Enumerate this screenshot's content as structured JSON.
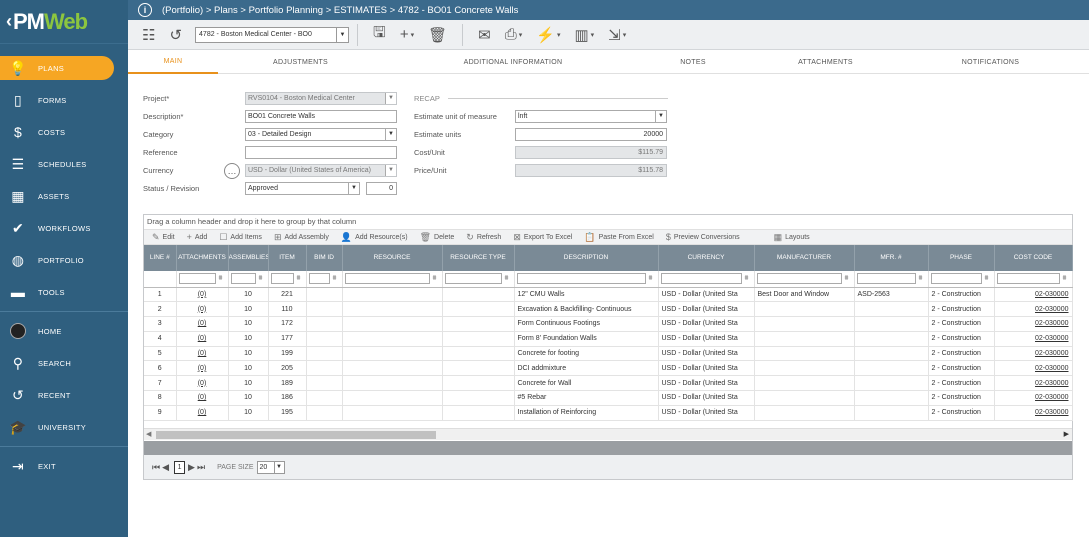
{
  "app": {
    "logo_prefix": "PM",
    "logo_suffix": "Web"
  },
  "breadcrumb": "(Portfolio) > Plans > Portfolio Planning > ESTIMATES > 4782 - BO01 Concrete Walls",
  "sidebar": {
    "items": [
      {
        "label": "PLANS",
        "icon": "lightbulb-icon"
      },
      {
        "label": "FORMS",
        "icon": "document-icon"
      },
      {
        "label": "COSTS",
        "icon": "dollar-icon"
      },
      {
        "label": "SCHEDULES",
        "icon": "schedule-icon"
      },
      {
        "label": "ASSETS",
        "icon": "building-icon"
      },
      {
        "label": "WORKFLOWS",
        "icon": "check-icon"
      },
      {
        "label": "PORTFOLIO",
        "icon": "globe-icon"
      },
      {
        "label": "TOOLS",
        "icon": "toolbox-icon"
      },
      {
        "label": "HOME",
        "icon": "avatar-icon"
      },
      {
        "label": "SEARCH",
        "icon": "search-icon"
      },
      {
        "label": "RECENT",
        "icon": "history-icon"
      },
      {
        "label": "UNIVERSITY",
        "icon": "graduation-icon"
      },
      {
        "label": "EXIT",
        "icon": "exit-icon"
      }
    ]
  },
  "toolbar": {
    "record_select": "4782 - Boston Medical Center - BO0"
  },
  "tabs": [
    "MAIN",
    "ADJUSTMENTS",
    "ADDITIONAL INFORMATION",
    "NOTES",
    "ATTACHMENTS",
    "NOTIFICATIONS"
  ],
  "form": {
    "project_label": "Project*",
    "project_value": "RVS0104 - Boston Medical Center",
    "description_label": "Description*",
    "description_value": "BO01 Concrete Walls",
    "category_label": "Category",
    "category_value": "03 - Detailed Design",
    "reference_label": "Reference",
    "reference_value": "",
    "currency_label": "Currency",
    "currency_value": "USD - Dollar (United States of America)",
    "status_label": "Status / Revision",
    "status_value": "Approved",
    "revision_value": "0",
    "recap_label": "RECAP",
    "uom_label": "Estimate unit of measure",
    "uom_value": "lnft",
    "units_label": "Estimate units",
    "units_value": "20000",
    "cost_unit_label": "Cost/Unit",
    "cost_unit_value": "$115.79",
    "price_unit_label": "Price/Unit",
    "price_unit_value": "$115.78"
  },
  "grid": {
    "group_hint": "Drag a column header and drop it here to group by that column",
    "tools": [
      "Edit",
      "Add",
      "Add Items",
      "Add Assembly",
      "Add Resource(s)",
      "Delete",
      "Refresh",
      "Export To Excel",
      "Paste From Excel",
      "Preview Conversions",
      "Layouts"
    ],
    "columns": [
      "LINE #",
      "ATTACHMENTS",
      "ASSEMBLIES",
      "ITEM",
      "BIM ID",
      "RESOURCE",
      "RESOURCE TYPE",
      "DESCRIPTION",
      "CURRENCY",
      "MANUFACTURER",
      "MFR. #",
      "PHASE",
      "COST CODE"
    ],
    "rows": [
      {
        "line": "1",
        "att": "(0)",
        "asm": "10",
        "item": "221",
        "desc": "12\" CMU Walls",
        "cur": "USD - Dollar (United Sta",
        "mfr": "Best Door and Window",
        "mfrno": "ASD-2563",
        "phase": "2 - Construction",
        "code": "02-030000"
      },
      {
        "line": "2",
        "att": "(0)",
        "asm": "10",
        "item": "110",
        "desc": "Excavation & Backfilling- Continuous",
        "cur": "USD - Dollar (United Sta",
        "mfr": "",
        "mfrno": "",
        "phase": "2 - Construction",
        "code": "02-030000"
      },
      {
        "line": "3",
        "att": "(0)",
        "asm": "10",
        "item": "172",
        "desc": "Form Continuous Footings",
        "cur": "USD - Dollar (United Sta",
        "mfr": "",
        "mfrno": "",
        "phase": "2 - Construction",
        "code": "02-030000"
      },
      {
        "line": "4",
        "att": "(0)",
        "asm": "10",
        "item": "177",
        "desc": "Form 8' Foundation Walls",
        "cur": "USD - Dollar (United Sta",
        "mfr": "",
        "mfrno": "",
        "phase": "2 - Construction",
        "code": "02-030000"
      },
      {
        "line": "5",
        "att": "(0)",
        "asm": "10",
        "item": "199",
        "desc": "Concrete for footing",
        "cur": "USD - Dollar (United Sta",
        "mfr": "",
        "mfrno": "",
        "phase": "2 - Construction",
        "code": "02-030000"
      },
      {
        "line": "6",
        "att": "(0)",
        "asm": "10",
        "item": "205",
        "desc": "DCI addmixture",
        "cur": "USD - Dollar (United Sta",
        "mfr": "",
        "mfrno": "",
        "phase": "2 - Construction",
        "code": "02-030000"
      },
      {
        "line": "7",
        "att": "(0)",
        "asm": "10",
        "item": "189",
        "desc": "Concrete for Wall",
        "cur": "USD - Dollar (United Sta",
        "mfr": "",
        "mfrno": "",
        "phase": "2 - Construction",
        "code": "02-030000"
      },
      {
        "line": "8",
        "att": "(0)",
        "asm": "10",
        "item": "186",
        "desc": "#5 Rebar",
        "cur": "USD - Dollar (United Sta",
        "mfr": "",
        "mfrno": "",
        "phase": "2 - Construction",
        "code": "02-030000"
      },
      {
        "line": "9",
        "att": "(0)",
        "asm": "10",
        "item": "195",
        "desc": "Installation of Reinforcing",
        "cur": "USD - Dollar (United Sta",
        "mfr": "",
        "mfrno": "",
        "phase": "2 - Construction",
        "code": "02-030000"
      }
    ]
  },
  "pager": {
    "page": "1",
    "page_size_label": "PAGE SIZE",
    "page_size": "20"
  },
  "colors": {
    "sidebar": "#2f5f7f",
    "accent": "#f6a623",
    "header": "#3b6a8c",
    "grid_header": "#7a8a96"
  }
}
